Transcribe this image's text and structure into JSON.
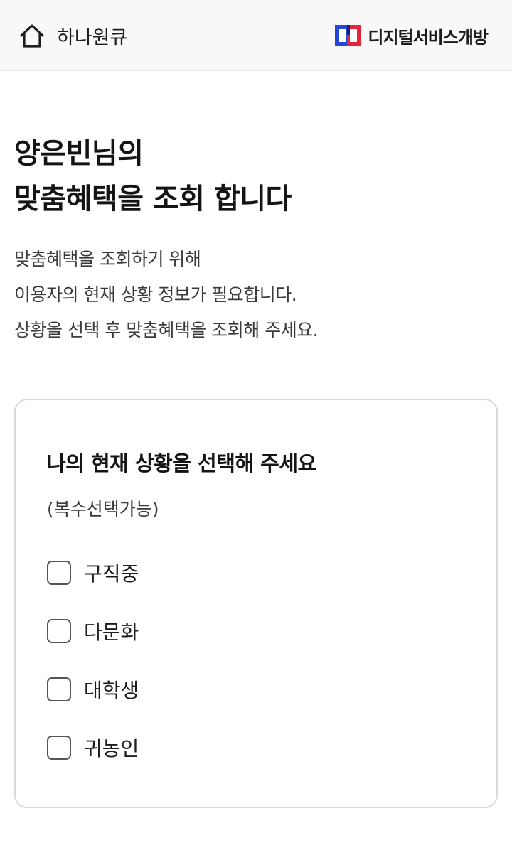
{
  "header": {
    "home_label": "하나원큐",
    "brand_label": "디지털서비스개방",
    "brand_colors": {
      "blue": "#2447d6",
      "red": "#e3243b"
    }
  },
  "title": {
    "line1": "양은빈님의",
    "line2": "맞춤혜택을 조회 합니다"
  },
  "description": {
    "line1": "맞춤혜택을 조회하기 위해",
    "line2": "이용자의 현재 상황 정보가 필요합니다.",
    "line3": "상황을 선택 후 맞춤혜택을 조회해 주세요."
  },
  "situation_card": {
    "title": "나의 현재 상황을 선택해 주세요",
    "subtitle": "(복수선택가능)",
    "options": [
      {
        "label": "구직중",
        "checked": false
      },
      {
        "label": "다문화",
        "checked": false
      },
      {
        "label": "대학생",
        "checked": false
      },
      {
        "label": "귀농인",
        "checked": false
      }
    ]
  }
}
